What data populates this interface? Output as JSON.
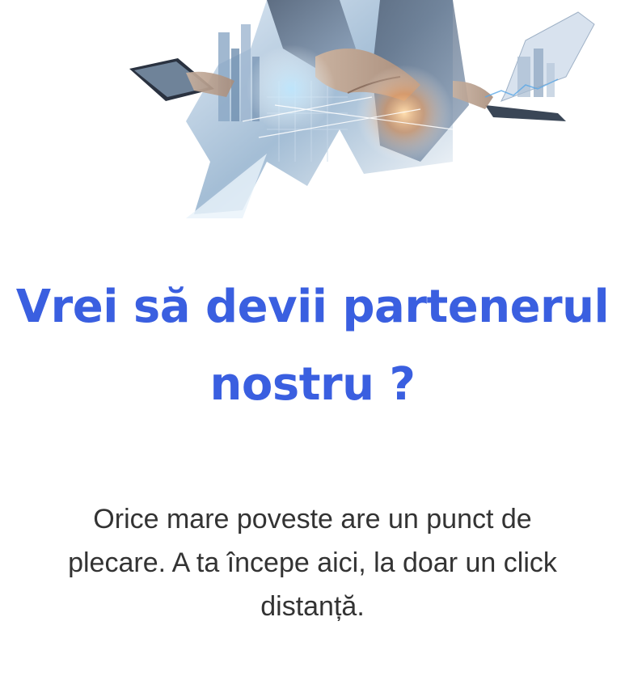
{
  "hero": {
    "image_description": "business-handshake-city-illustration"
  },
  "headline": {
    "line1": "Vrei să devii partenerul",
    "line2": "nostru ?"
  },
  "subtext": {
    "line1": "Orice mare poveste are un punct de",
    "line2": "plecare. A ta începe aici, la doar un click",
    "line3": "distanță."
  },
  "colors": {
    "headline": "#3a5fe0",
    "body_text": "#333333",
    "background": "#ffffff"
  }
}
